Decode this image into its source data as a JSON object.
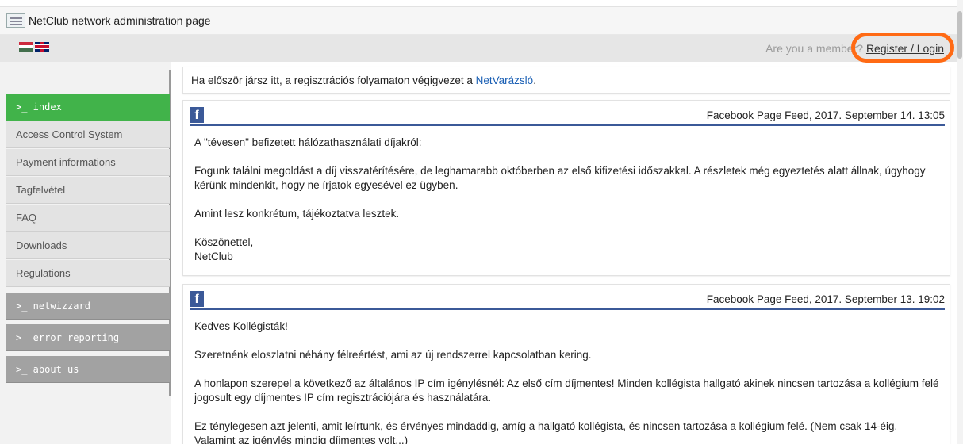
{
  "window": {
    "title": "NetClub network administration page"
  },
  "header": {
    "member_question": "Are you a member?",
    "login_link": "Register / Login",
    "languages": [
      "hu",
      "en"
    ]
  },
  "sidebar": {
    "items": [
      {
        "label": ">_ index",
        "type": "section",
        "active": true
      },
      {
        "label": "Access Control System",
        "type": "link"
      },
      {
        "label": "Payment informations",
        "type": "link"
      },
      {
        "label": "Tagfelvétel",
        "type": "link"
      },
      {
        "label": "FAQ",
        "type": "link"
      },
      {
        "label": "Downloads",
        "type": "link"
      },
      {
        "label": "Regulations",
        "type": "link"
      },
      {
        "label": ">_ netwizzard",
        "type": "section"
      },
      {
        "label": ">_ error reporting",
        "type": "section"
      },
      {
        "label": ">_ about us",
        "type": "section"
      }
    ]
  },
  "notice": {
    "text": "Ha először jársz itt, a regisztrációs folyamaton végigvezet a ",
    "link": "NetVarázsló",
    "suffix": "."
  },
  "posts": [
    {
      "source": "Facebook Page Feed, 2017. September 14. 13:05",
      "paragraphs": [
        "A \"tévesen\" befizetett hálózathasználati díjakról:",
        "Fogunk találni megoldást a díj visszatérítésére, de leghamarabb októberben az első kifizetési időszakkal. A részletek még egyeztetés alatt állnak, úgyhogy kérünk mindenkit, hogy ne írjatok egyesével ez ügyben.",
        "Amint lesz konkrétum, tájékoztatva lesztek.",
        "Köszönettel,\nNetClub"
      ]
    },
    {
      "source": "Facebook Page Feed, 2017. September 13. 19:02",
      "paragraphs": [
        "Kedves Kollégisták!",
        "Szeretnénk eloszlatni néhány félreértést, ami az új rendszerrel kapcsolatban kering.",
        "A honlapon szerepel a következő az általános IP cím igénylésnél: Az első cím díjmentes! Minden kollégista hallgató akinek nincsen tartozása a kollégium felé jogosult egy díjmentes IP cím regisztrációjára és használatára.",
        "Ez ténylegesen azt jelenti, amit leírtunk, és érvényes mindaddig, amíg a hallgató kollégista, és nincsen tartozása a kollégium felé. (Nem csak 14-éig. Valamint az igénylés mindig díjmentes volt...)"
      ]
    }
  ],
  "icons": {
    "facebook": "facebook-icon",
    "favicon": "netclub-favicon-icon"
  },
  "colors": {
    "active": "#41b34a",
    "facebook": "#3b5998",
    "highlight": "#ff6a14",
    "link": "#1a5fb4"
  }
}
